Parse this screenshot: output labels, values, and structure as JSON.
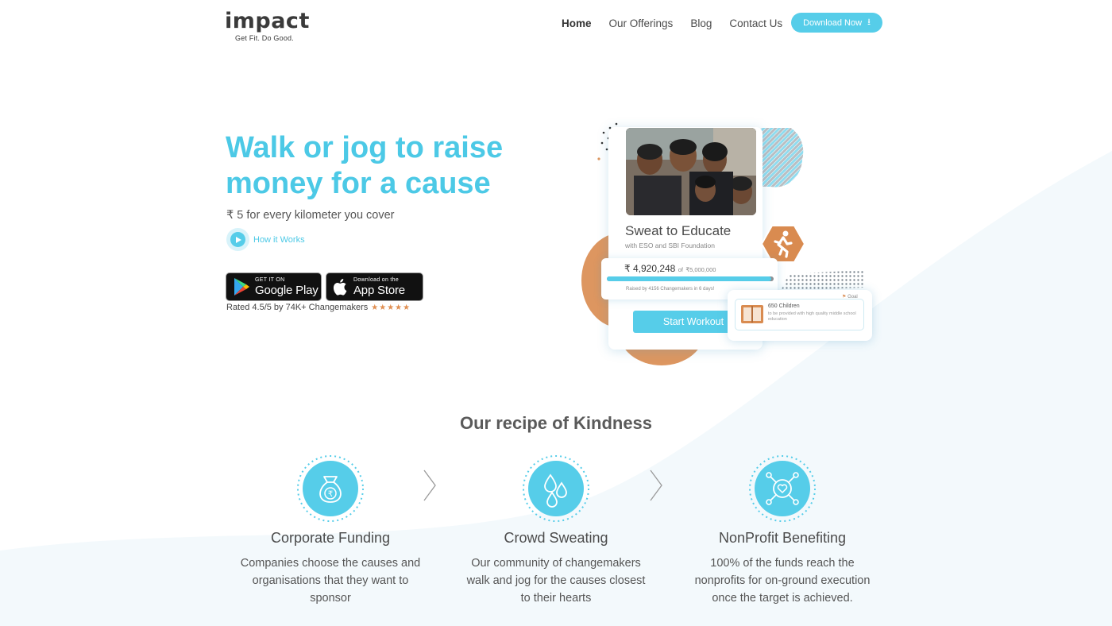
{
  "brand": {
    "name": "impact",
    "tagline": "Get Fit. Do Good."
  },
  "nav": {
    "items": [
      "Home",
      "Our Offerings",
      "Blog",
      "Contact Us"
    ],
    "active": "Home",
    "download_label": "Download Now"
  },
  "hero": {
    "title": "Walk or jog to raise money for a cause",
    "subtitle": "₹ 5 for every kilometer you cover",
    "how_it_works": "How it Works",
    "google_play": {
      "small": "GET IT ON",
      "big": "Google Play"
    },
    "app_store": {
      "small": "Download on the",
      "big": "App Store"
    },
    "rating": "Rated 4.5/5 by 74K+ Changemakers",
    "stars": 5
  },
  "campaign_card": {
    "title": "Sweat to Educate",
    "subtitle": "with ESO and SBI Foundation",
    "raised": "₹ 4,920,248",
    "goal": "₹5,000,000",
    "goal_prefix": "of",
    "progress": 0.984,
    "raised_by": "Raised by 4156 Changemakers in 6 days!",
    "start_button": "Start Workout",
    "goal_badge": "Goal",
    "goal_title": "650 Children",
    "goal_desc": "to be provided with high quality middle school education"
  },
  "recipe": {
    "title": "Our recipe of Kindness",
    "steps": [
      {
        "title": "Corporate Funding",
        "desc": "Companies choose the causes and organisations that they want to sponsor",
        "icon": "money-bag-icon"
      },
      {
        "title": "Crowd Sweating",
        "desc": "Our community of changemakers walk and jog for the causes closest to their hearts",
        "icon": "sweat-drops-icon"
      },
      {
        "title": "NonProfit Benefiting",
        "desc": "100% of the funds reach the nonprofits for on-ground execution once the target is achieved.",
        "icon": "heart-network-icon"
      }
    ]
  },
  "colors": {
    "accent": "#4cc9e6",
    "button": "#56cde9",
    "orange": "#dd9660",
    "text": "#4b4b4b",
    "wave": "#f3f9fc"
  }
}
